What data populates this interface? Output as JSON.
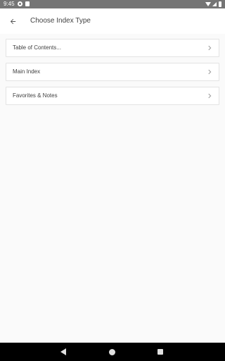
{
  "status_bar": {
    "time": "9:45"
  },
  "app_bar": {
    "title": "Choose Index Type",
    "back_icon": "arrow-back-icon"
  },
  "index_options": [
    {
      "label": "Table of Contents..."
    },
    {
      "label": "Main Index"
    },
    {
      "label": "Favorites & Notes"
    }
  ],
  "colors": {
    "status_bar": "#757575",
    "background": "#fafafa",
    "card": "#ffffff",
    "nav_bar": "#000000",
    "text": "#424242"
  }
}
